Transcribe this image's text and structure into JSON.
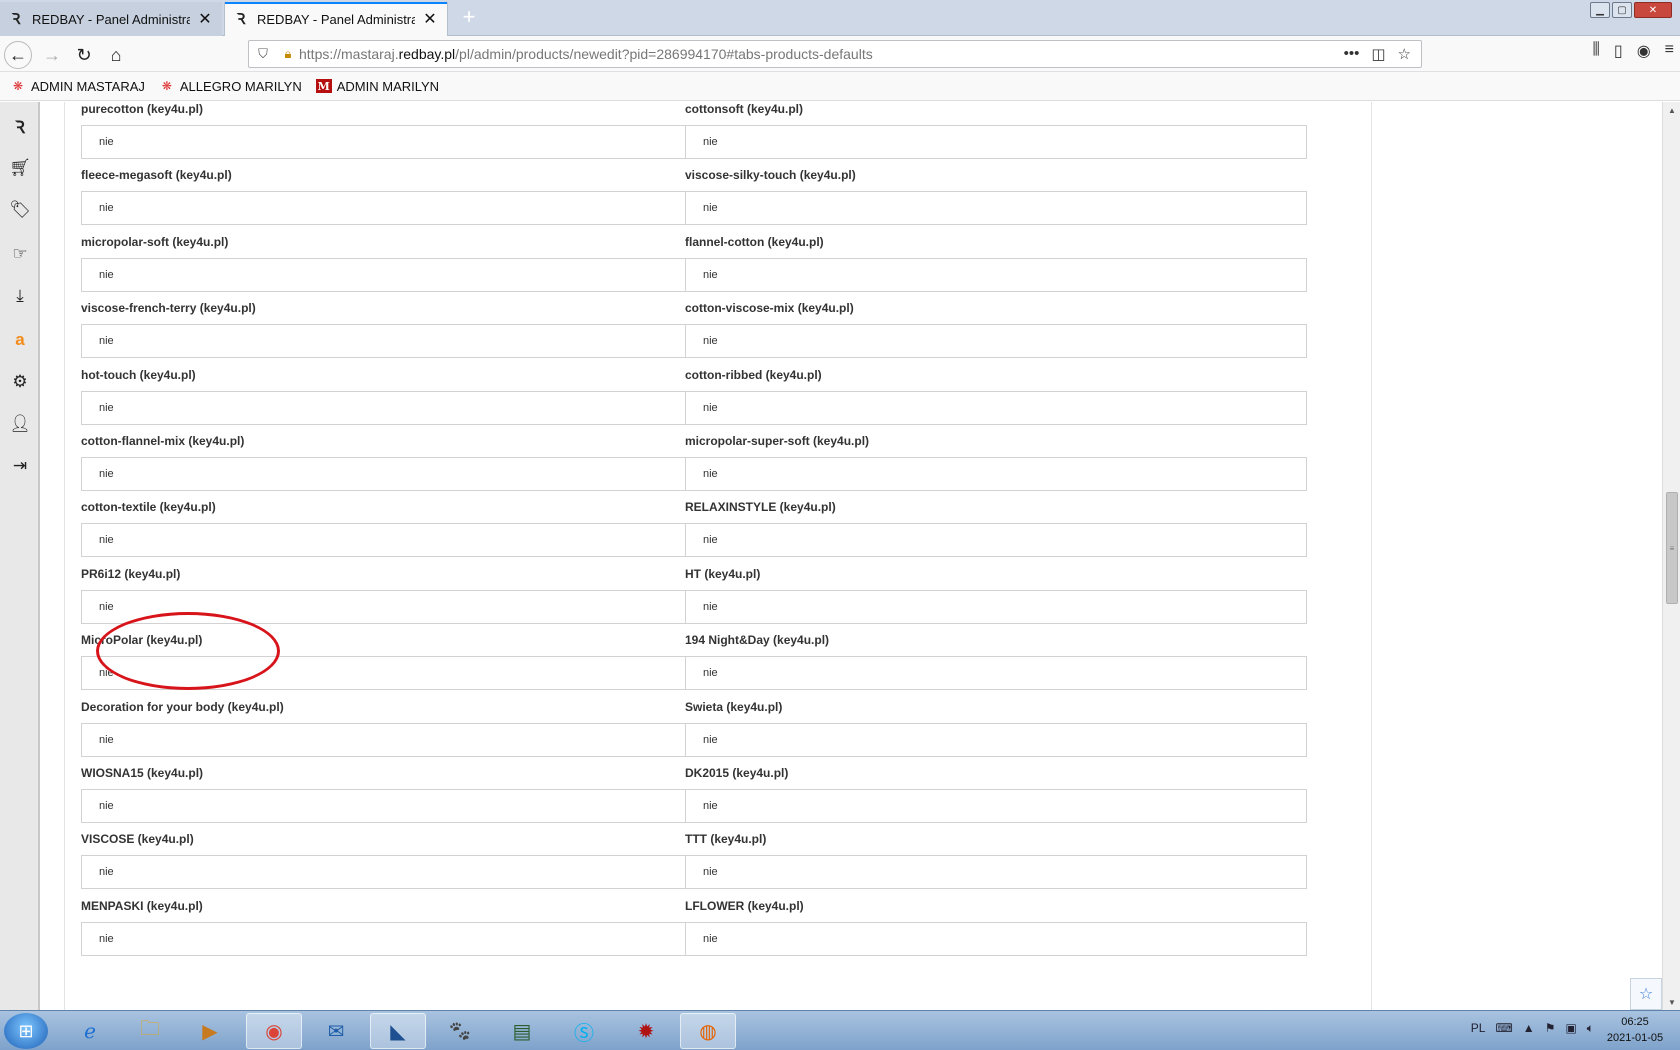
{
  "browser": {
    "tabs": [
      {
        "title": "REDBAY - Panel Administracyjny",
        "active": false
      },
      {
        "title": "REDBAY - Panel Administracyjny",
        "active": true
      }
    ],
    "url": {
      "prefix": "https://mastaraj.",
      "domain": "redbay.pl",
      "path": "/pl/admin/products/newedit?pid=286994170#tabs-products-defaults"
    },
    "bookmarks": [
      {
        "label": "ADMIN MASTARAJ",
        "icon": "redbay-icon"
      },
      {
        "label": "ALLEGRO MARILYN",
        "icon": "redbay-icon"
      },
      {
        "label": "ADMIN MARILYN",
        "icon": "marilyn-icon"
      }
    ]
  },
  "fields_left": [
    {
      "label": "purecotton (key4u.pl)",
      "value": "nie"
    },
    {
      "label": "fleece-megasoft (key4u.pl)",
      "value": "nie"
    },
    {
      "label": "micropolar-soft (key4u.pl)",
      "value": "nie"
    },
    {
      "label": "viscose-french-terry (key4u.pl)",
      "value": "nie"
    },
    {
      "label": "hot-touch (key4u.pl)",
      "value": "nie"
    },
    {
      "label": "cotton-flannel-mix (key4u.pl)",
      "value": "nie"
    },
    {
      "label": "cotton-textile (key4u.pl)",
      "value": "nie"
    },
    {
      "label": "PR6i12 (key4u.pl)",
      "value": "nie"
    },
    {
      "label": "MicroPolar (key4u.pl)",
      "value": "nie"
    },
    {
      "label": "Decoration for your body (key4u.pl)",
      "value": "nie"
    },
    {
      "label": "WIOSNA15 (key4u.pl)",
      "value": "nie"
    },
    {
      "label": "VISCOSE (key4u.pl)",
      "value": "nie"
    },
    {
      "label": "MENPASKI (key4u.pl)",
      "value": "nie"
    }
  ],
  "fields_right": [
    {
      "label": "cottonsoft (key4u.pl)",
      "value": "nie"
    },
    {
      "label": "viscose-silky-touch (key4u.pl)",
      "value": "nie"
    },
    {
      "label": "flannel-cotton (key4u.pl)",
      "value": "nie"
    },
    {
      "label": "cotton-viscose-mix (key4u.pl)",
      "value": "nie"
    },
    {
      "label": "cotton-ribbed (key4u.pl)",
      "value": "nie"
    },
    {
      "label": "micropolar-super-soft (key4u.pl)",
      "value": "nie"
    },
    {
      "label": "RELAXINSTYLE (key4u.pl)",
      "value": "nie"
    },
    {
      "label": "HT (key4u.pl)",
      "value": "nie"
    },
    {
      "label": "194 Night&Day (key4u.pl)",
      "value": "nie"
    },
    {
      "label": "Swieta (key4u.pl)",
      "value": "nie"
    },
    {
      "label": "DK2015 (key4u.pl)",
      "value": "nie"
    },
    {
      "label": "TTT (key4u.pl)",
      "value": "nie"
    },
    {
      "label": "LFLOWER (key4u.pl)",
      "value": "nie"
    }
  ],
  "highlight_color": "#d8141b",
  "taskbar": {
    "tray_lang": "PL",
    "time": "06:25",
    "date": "2021-01-05"
  }
}
